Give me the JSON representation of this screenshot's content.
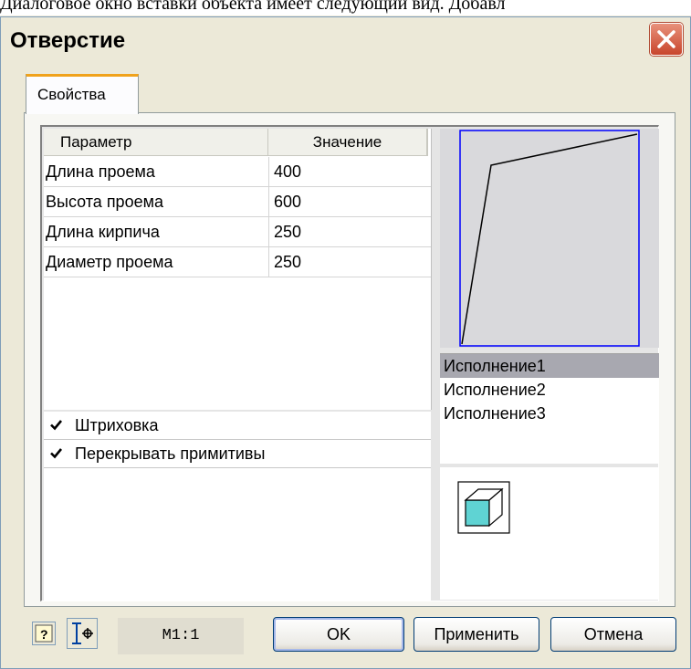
{
  "document": {
    "caption_text": "Диалоговое окно вставки объекта имеет следующий вид. Добавл"
  },
  "window": {
    "title": "Отверстие"
  },
  "tabs": [
    {
      "label": "Свойства",
      "active": true
    }
  ],
  "params_table": {
    "headers": [
      "Параметр",
      "Значение"
    ],
    "rows": [
      {
        "name": "Длина проема",
        "value": "400"
      },
      {
        "name": "Высота проема",
        "value": "600"
      },
      {
        "name": "Длина кирпича",
        "value": "250"
      },
      {
        "name": "Диаметр проема",
        "value": "250"
      }
    ]
  },
  "options": [
    {
      "label": "Штриховка",
      "checked": true
    },
    {
      "label": "Перекрывать примитивы",
      "checked": true
    }
  ],
  "variants": {
    "items": [
      "Исполнение1",
      "Исполнение2",
      "Исполнение3"
    ],
    "selected": "Исполнение1"
  },
  "footer": {
    "scale": "M1:1",
    "ok_label": "OK",
    "apply_label": "Применить",
    "cancel_label": "Отмена"
  },
  "colors": {
    "accent": "#f0a21b",
    "preview_frame": "#0000ff",
    "cube_face": "#5fd3d3",
    "close_button": "#c8452c"
  }
}
